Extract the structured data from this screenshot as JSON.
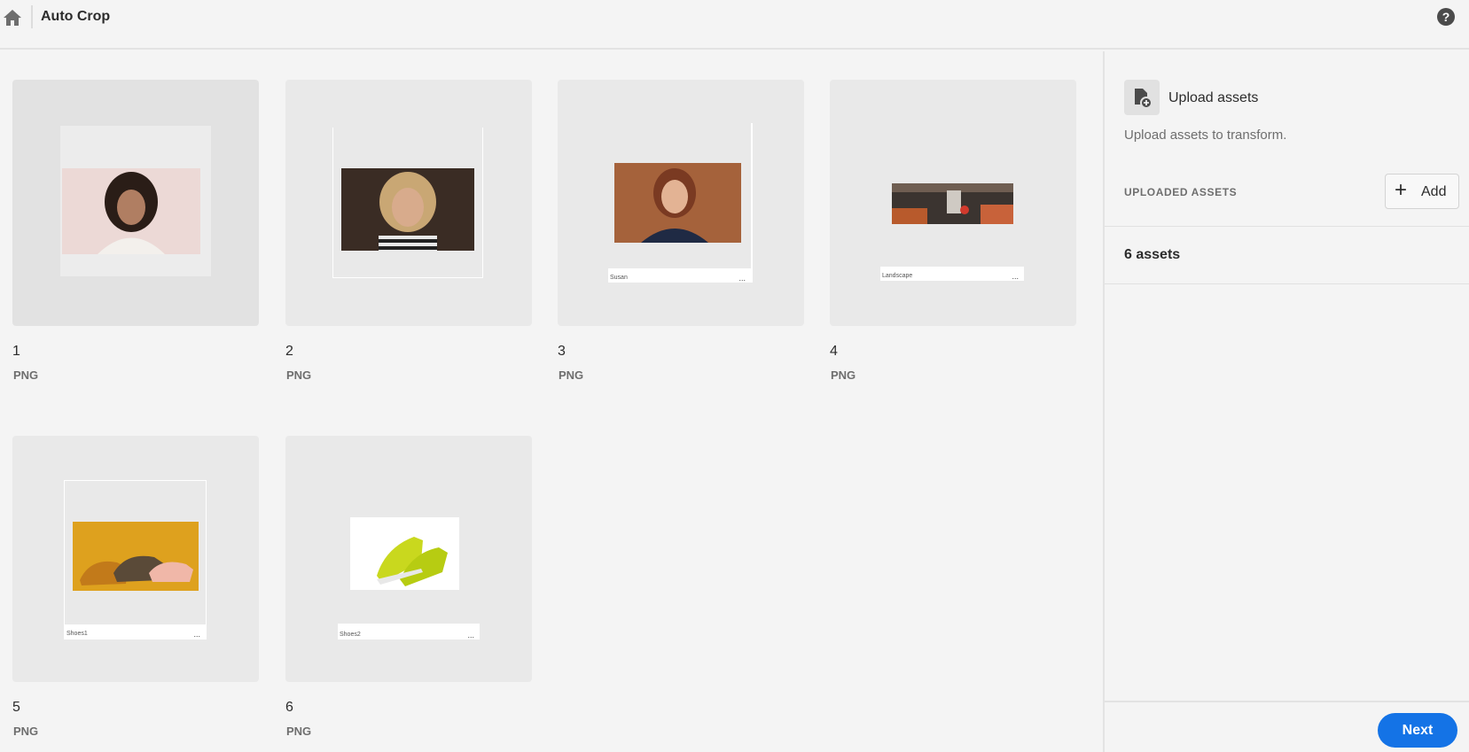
{
  "header": {
    "title": "Auto Crop",
    "home_icon": "home-icon",
    "help_icon": "help-icon",
    "help_glyph": "?"
  },
  "assets": [
    {
      "name": "1",
      "type": "PNG",
      "caption": ""
    },
    {
      "name": "2",
      "type": "PNG",
      "caption": ""
    },
    {
      "name": "3",
      "type": "PNG",
      "caption": "Susan",
      "menu": "..."
    },
    {
      "name": "4",
      "type": "PNG",
      "caption": "Landscape",
      "menu": "..."
    },
    {
      "name": "5",
      "type": "PNG",
      "caption": "Shoes1",
      "menu": "..."
    },
    {
      "name": "6",
      "type": "PNG",
      "caption": "Shoes2",
      "menu": "..."
    }
  ],
  "panel": {
    "upload_title": "Upload assets",
    "upload_description": "Upload assets to transform.",
    "section_label": "UPLOADED ASSETS",
    "add_label": "Add",
    "add_glyph": "+",
    "asset_count": "6 assets",
    "next_label": "Next"
  },
  "colors": {
    "accent": "#1473e6",
    "background": "#f4f4f4"
  }
}
